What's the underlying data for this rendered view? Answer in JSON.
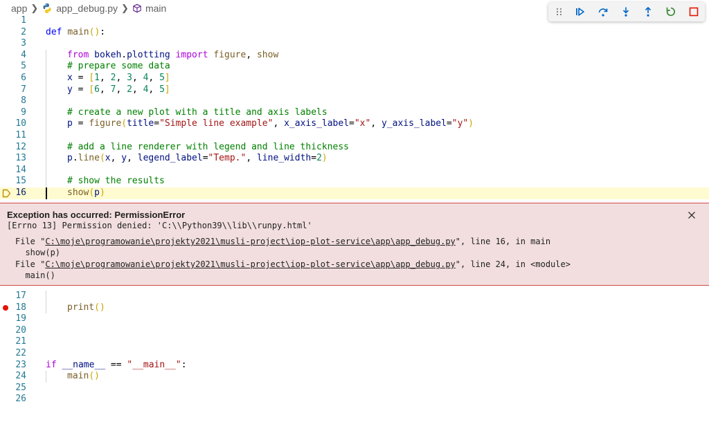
{
  "breadcrumb": {
    "folder": "app",
    "file": "app_debug.py",
    "symbol": "main"
  },
  "debug_toolbar": {
    "buttons": [
      "continue",
      "step-over",
      "step-into",
      "step-out",
      "restart",
      "stop"
    ]
  },
  "editor": {
    "current_line": 16,
    "breakpoint_line": 18,
    "lines_top": [
      {
        "n": "1"
      },
      {
        "n": "2",
        "t": [
          [
            "kw",
            "def "
          ],
          [
            "fn",
            "main"
          ],
          [
            "br",
            "()"
          ],
          [
            "",
            ":"
          ]
        ]
      },
      {
        "n": "3"
      },
      {
        "n": "4",
        "t": [
          [
            "ctl",
            "from "
          ],
          [
            "var",
            "bokeh"
          ],
          [
            "",
            "."
          ],
          [
            "var",
            "plotting"
          ],
          [
            "ctl",
            " import "
          ],
          [
            "fn",
            "figure"
          ],
          [
            "",
            ", "
          ],
          [
            "fn",
            "show"
          ]
        ]
      },
      {
        "n": "5",
        "t": [
          [
            "cm",
            "# prepare some data"
          ]
        ]
      },
      {
        "n": "6",
        "t": [
          [
            "var",
            "x"
          ],
          [
            "",
            " = "
          ],
          [
            "br",
            "["
          ],
          [
            "num",
            "1"
          ],
          [
            "",
            ", "
          ],
          [
            "num",
            "2"
          ],
          [
            "",
            ", "
          ],
          [
            "num",
            "3"
          ],
          [
            "",
            ", "
          ],
          [
            "num",
            "4"
          ],
          [
            "",
            ", "
          ],
          [
            "num",
            "5"
          ],
          [
            "br",
            "]"
          ]
        ]
      },
      {
        "n": "7",
        "t": [
          [
            "var",
            "y"
          ],
          [
            "",
            " = "
          ],
          [
            "br",
            "["
          ],
          [
            "num",
            "6"
          ],
          [
            "",
            ", "
          ],
          [
            "num",
            "7"
          ],
          [
            "",
            ", "
          ],
          [
            "num",
            "2"
          ],
          [
            "",
            ", "
          ],
          [
            "num",
            "4"
          ],
          [
            "",
            ", "
          ],
          [
            "num",
            "5"
          ],
          [
            "br",
            "]"
          ]
        ]
      },
      {
        "n": "8"
      },
      {
        "n": "9",
        "t": [
          [
            "cm",
            "# create a new plot with a title and axis labels"
          ]
        ]
      },
      {
        "n": "10",
        "t": [
          [
            "var",
            "p"
          ],
          [
            "",
            " = "
          ],
          [
            "fn",
            "figure"
          ],
          [
            "br",
            "("
          ],
          [
            "var",
            "title"
          ],
          [
            "",
            "="
          ],
          [
            "str",
            "\"Simple line example\""
          ],
          [
            "",
            ", "
          ],
          [
            "var",
            "x_axis_label"
          ],
          [
            "",
            "="
          ],
          [
            "str",
            "\"x\""
          ],
          [
            "",
            ", "
          ],
          [
            "var",
            "y_axis_label"
          ],
          [
            "",
            "="
          ],
          [
            "str",
            "\"y\""
          ],
          [
            "br",
            ")"
          ]
        ]
      },
      {
        "n": "11"
      },
      {
        "n": "12",
        "t": [
          [
            "cm",
            "# add a line renderer with legend and line thickness"
          ]
        ]
      },
      {
        "n": "13",
        "t": [
          [
            "var",
            "p"
          ],
          [
            "",
            "."
          ],
          [
            "fn",
            "line"
          ],
          [
            "br",
            "("
          ],
          [
            "var",
            "x"
          ],
          [
            "",
            ", "
          ],
          [
            "var",
            "y"
          ],
          [
            "",
            ", "
          ],
          [
            "var",
            "legend_label"
          ],
          [
            "",
            "="
          ],
          [
            "str",
            "\"Temp.\""
          ],
          [
            "",
            ", "
          ],
          [
            "var",
            "line_width"
          ],
          [
            "",
            "="
          ],
          [
            "num",
            "2"
          ],
          [
            "br",
            ")"
          ]
        ]
      },
      {
        "n": "14"
      },
      {
        "n": "15",
        "t": [
          [
            "cm",
            "# show the results"
          ]
        ]
      },
      {
        "n": "16",
        "t": [
          [
            "fn",
            "show"
          ],
          [
            "br",
            "("
          ],
          [
            "var",
            "p"
          ],
          [
            "br",
            ")"
          ]
        ]
      }
    ],
    "lines_bottom": [
      {
        "n": "17"
      },
      {
        "n": "18",
        "t": [
          [
            "fn",
            "print"
          ],
          [
            "br",
            "()"
          ]
        ]
      },
      {
        "n": "19"
      },
      {
        "n": "20"
      },
      {
        "n": "21"
      },
      {
        "n": "22"
      },
      {
        "n": "23",
        "t": [
          [
            "ctl",
            "if "
          ],
          [
            "var",
            "__name__"
          ],
          [
            "",
            " == "
          ],
          [
            "str",
            "\"__main__\""
          ],
          [
            "",
            ":"
          ]
        ]
      },
      {
        "n": "24",
        "t": [
          [
            "fn",
            "main"
          ],
          [
            "br",
            "()"
          ]
        ]
      },
      {
        "n": "25"
      },
      {
        "n": "26"
      }
    ]
  },
  "exception": {
    "title": "Exception has occurred: PermissionError",
    "message": "[Errno 13] Permission denied: 'C:\\\\Python39\\\\lib\\\\runpy.html'",
    "tb1_prefix": "File \"",
    "tb1_path": "C:\\moje\\programowanie\\projekty2021\\musli-project\\iop-plot-service\\app\\app_debug.py",
    "tb1_suffix": "\", line 16, in main",
    "tb1_code": "  show(p)",
    "tb2_prefix": "File \"",
    "tb2_path": "C:\\moje\\programowanie\\projekty2021\\musli-project\\iop-plot-service\\app\\app_debug.py",
    "tb2_suffix": "\", line 24, in <module>",
    "tb2_code": "  main()"
  }
}
